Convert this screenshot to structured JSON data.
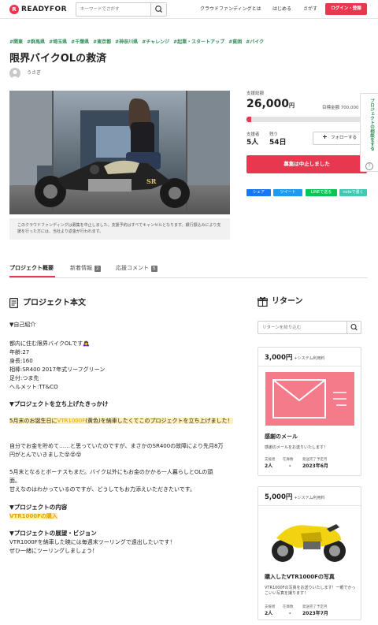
{
  "header": {
    "logo_mark": "R",
    "logo_text": "READYFOR",
    "search_placeholder": "キーワードでさがす",
    "nav": [
      "クラウドファンディングとは",
      "はじめる",
      "さがす"
    ],
    "login_label": "ログイン・登録"
  },
  "project": {
    "tags": [
      "#関東",
      "#群馬県",
      "#埼玉県",
      "#千葉県",
      "#東京都",
      "#神奈川県",
      "#チャレンジ",
      "#起業・スタートアップ",
      "#貧困",
      "#バイク"
    ],
    "title": "限界バイクOLの救済",
    "owner": "うさぎ",
    "notice": "このクラウドファンディングは募集を中止しました。支援予約はすべてキャンセルとなります。銀行振込みにより支援を行った方には、当社より返金が行われます。"
  },
  "stats": {
    "raised_label": "支援総額",
    "raised_amount": "26,000",
    "currency": "円",
    "goal_label": "目標金額",
    "goal_amount": "700,000",
    "progress_fraction": 0.04,
    "supporters_label": "支援者",
    "supporters_value": "5人",
    "remaining_label": "残り",
    "remaining_value": "54日",
    "follow_label": "フォローする",
    "stopped_label": "募集は中止しました"
  },
  "share": {
    "facebook": "シェア",
    "twitter": "ツイート",
    "line": "LINEで送る",
    "note": "noteで書く"
  },
  "side_tab": {
    "text": "プロジェクトの相談をする",
    "q": "?"
  },
  "tabs": [
    {
      "label": "プロジェクト概要"
    },
    {
      "label": "新着情報",
      "count": "2"
    },
    {
      "label": "応援コメント",
      "count": "5"
    }
  ],
  "body": {
    "section_title": "プロジェクト本文",
    "intro_heading": "▼自己紹介",
    "intro_lines": [
      "都内に住む限界バイクOLです🙇‍♀️",
      "年齢:27",
      "身長:160",
      "相棒:SR400 2017年式リーフグリーン",
      "足付:つま先",
      "ヘルメット:TT&CO"
    ],
    "why_heading": "▼プロジェクトを立ち上げたきっかけ",
    "why_highlight": {
      "pre": "5月末のお誕生日に",
      "em": "VTR1000F",
      "post": "(黄色)を納車したくてこのプロジェクトを立ち上げました！"
    },
    "why_para1": [
      "自分でお金を貯めて……と思っていたのですが、まさかのSR400の故障により先月8万",
      "円がとんでいきました😵😵😵"
    ],
    "why_para2": [
      "5月末となるとボーナスもまだ。バイク以外にもお金のかかる一人暮らしとOLの頭",
      "面。",
      "甘えなのはわかっているのですが、どうしてもお力添えいただきたいです。"
    ],
    "content_heading": "▼プロジェクトの内容",
    "content_highlight": "VTR1000Fの購入",
    "vision_heading": "▼プロジェクトの展望・ビジョン",
    "vision_lines": [
      "VTR1000Fを納車した暁には毎週末ツーリングで遠出したいです！",
      "ぜひ一緒にツーリングしましょう！"
    ]
  },
  "rewards": {
    "section_title": "リターン",
    "filter_placeholder": "リターンを絞り込む",
    "meta_labels": [
      "支援者",
      "在庫数",
      "発送完了予定月"
    ],
    "cards": [
      {
        "price": "3,000",
        "currency": "円",
        "fee": "+システム利用料",
        "title": "感謝のメール",
        "desc": "感謝のメールをお送りいたします！",
        "supporters": "2人",
        "stock": "-",
        "ship": "2023年6月",
        "image": "mail-icon",
        "image_color": "#f47b8a"
      },
      {
        "price": "5,000",
        "currency": "円",
        "fee": "+システム利用料",
        "title": "購入したVTR1000Fの写真",
        "desc": "VTR1000Fの写真をお送りいたします！一眼でかっこいい写真を撮ります！",
        "supporters": "2人",
        "stock": "-",
        "ship": "2023年7月",
        "image": "motorcycle-photo"
      }
    ]
  }
}
